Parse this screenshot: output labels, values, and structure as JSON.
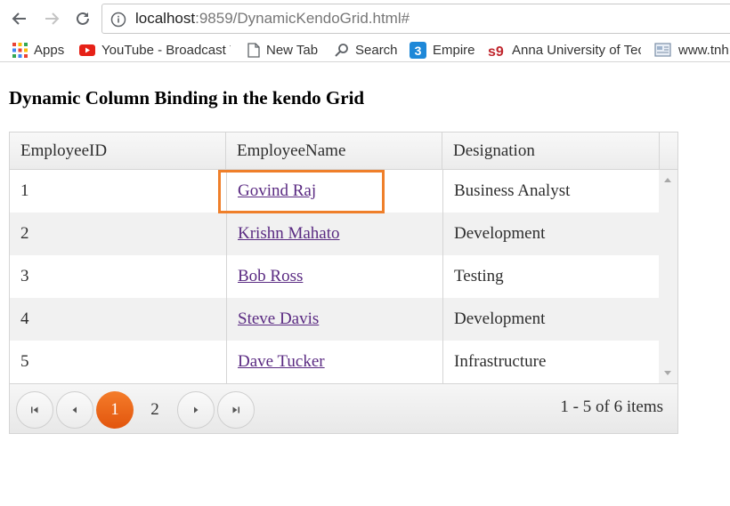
{
  "browser": {
    "url_host": "localhost",
    "url_rest": ":9859/DynamicKendoGrid.html#",
    "bookmarks": [
      {
        "label": "Apps",
        "icon": "apps-grid-icon"
      },
      {
        "label": "YouTube - Broadcast Y",
        "icon": "youtube-icon"
      },
      {
        "label": "New Tab",
        "icon": "page-icon"
      },
      {
        "label": "Search",
        "icon": "search-icon"
      },
      {
        "label": "Empire",
        "icon": "empire-icon"
      },
      {
        "label": "Anna University of Tec",
        "icon": "anna-university-icon"
      },
      {
        "label": "www.tnh",
        "icon": "site-icon"
      }
    ]
  },
  "page": {
    "title": "Dynamic Column Binding in the kendo Grid"
  },
  "grid": {
    "columns": [
      "EmployeeID",
      "EmployeeName",
      "Designation"
    ],
    "rows": [
      {
        "id": "1",
        "name": "Govind Raj",
        "designation": "Business Analyst"
      },
      {
        "id": "2",
        "name": "Krishn Mahato",
        "designation": "Development"
      },
      {
        "id": "3",
        "name": "Bob Ross",
        "designation": "Testing"
      },
      {
        "id": "4",
        "name": "Steve Davis",
        "designation": "Development"
      },
      {
        "id": "5",
        "name": "Dave Tucker",
        "designation": "Infrastructure"
      }
    ],
    "pager": {
      "pages": [
        "1",
        "2"
      ],
      "current_page": "1",
      "info": "1 - 5 of 6 items"
    }
  },
  "colors": {
    "accent": "#e8661a",
    "link": "#5a2a82",
    "highlight_box": "#ef7f2a"
  }
}
